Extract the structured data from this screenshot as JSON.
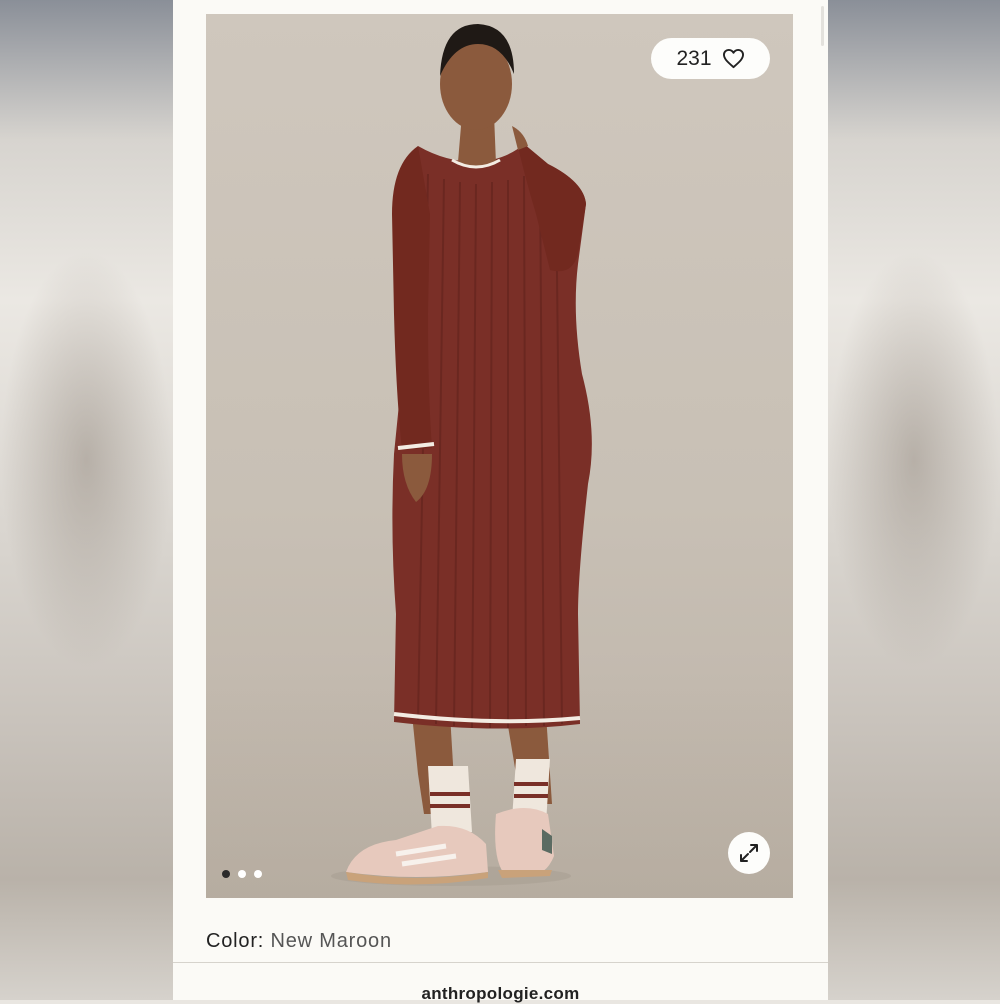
{
  "product": {
    "like_count": "231",
    "color_label": "Color:",
    "color_value": "New Maroon",
    "image_dots": 3,
    "active_dot": 1
  },
  "footer": {
    "site": "anthropologie.com"
  },
  "icons": {
    "like": "heart-icon",
    "expand": "expand-arrows-icon"
  },
  "colors": {
    "dress": "#7a2f27",
    "background": "#c8c0b5",
    "screen": "#fbfaf6"
  }
}
